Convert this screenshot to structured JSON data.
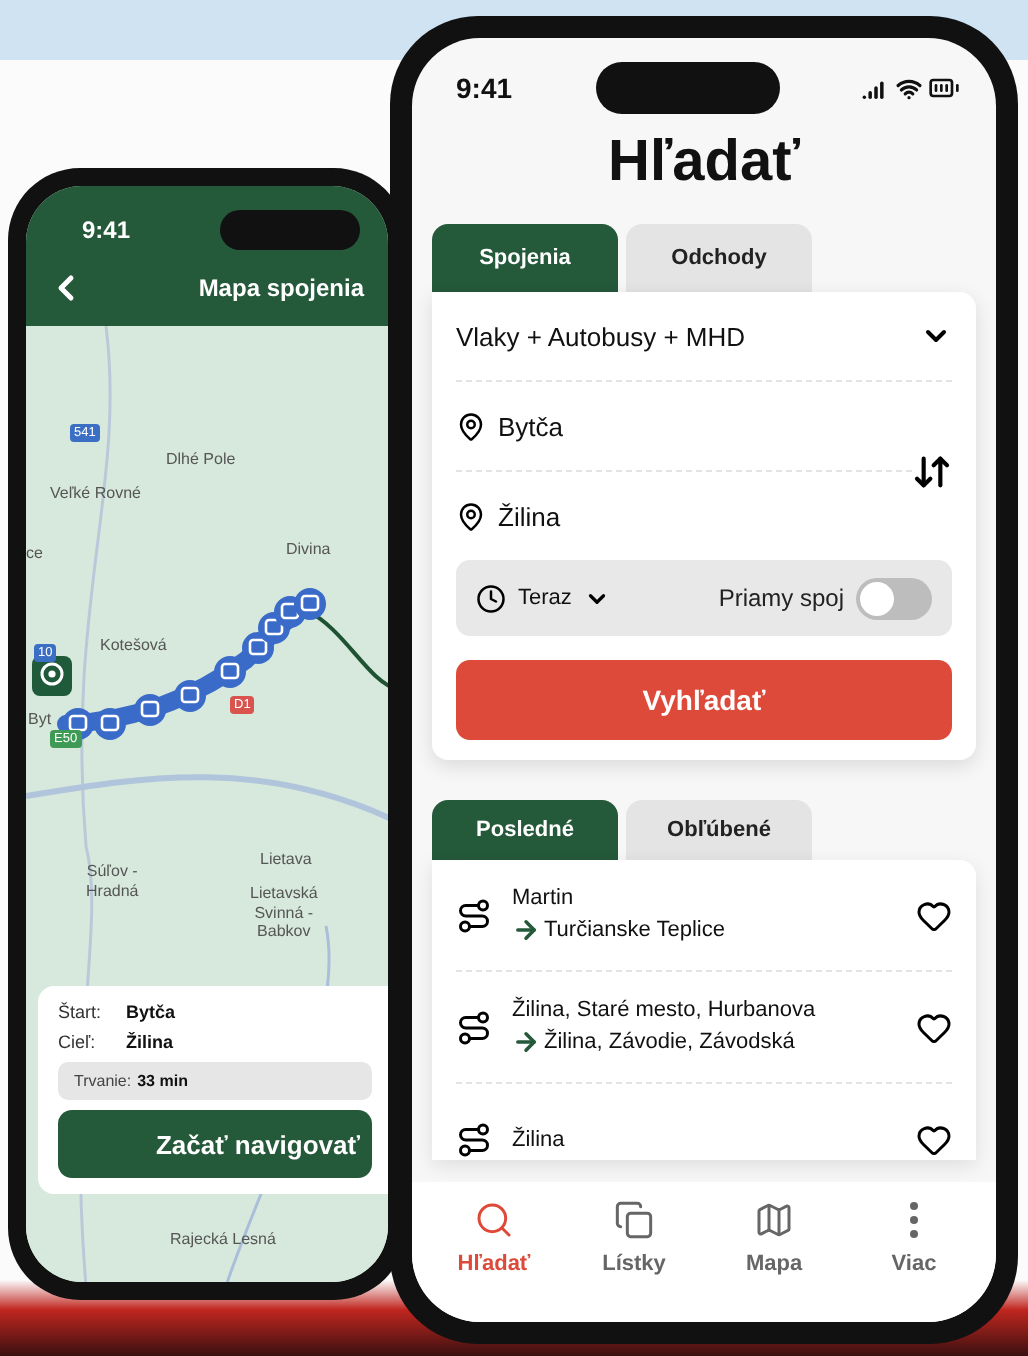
{
  "map_phone": {
    "status_time": "9:41",
    "header_title": "Mapa spojenia",
    "map": {
      "labels": [
        "Dlhé Pole",
        "Veľké Rovné",
        "ce",
        "Divina",
        "Kotešová",
        "Byt",
        "Súľov -\nHradná",
        "Lietava",
        "Lietavská\nSvinná -\nBabkov",
        "Rajecká Lesná"
      ],
      "road_signs": [
        {
          "text": "541",
          "color": "#3b6fc4"
        },
        {
          "text": "10",
          "color": "#3b6fc4"
        },
        {
          "text": "E50",
          "color": "#3f9a55"
        },
        {
          "text": "D1",
          "color": "#d9534f"
        }
      ]
    },
    "trip_card": {
      "start_label": "Štart:",
      "start": "Bytča",
      "end_label": "Cieľ:",
      "end": "Žilina",
      "duration_label": "Trvanie:",
      "duration": "33 min",
      "button": "Začať navigovať"
    }
  },
  "search_phone": {
    "status_time": "9:41",
    "title": "Hľadať",
    "mode_tabs": [
      {
        "label": "Spojenia",
        "selected": true
      },
      {
        "label": "Odchody",
        "selected": false
      }
    ],
    "transport_select": "Vlaky + Autobusy + MHD",
    "from": "Bytča",
    "to": "Žilina",
    "time": "Teraz",
    "direct": {
      "label": "Priamy spoj",
      "on": false
    },
    "search_button": "Vyhľadať",
    "list_tabs": [
      {
        "label": "Posledné",
        "selected": true
      },
      {
        "label": "Obľúbené",
        "selected": false
      }
    ],
    "recent": [
      {
        "from": "Martin",
        "to": "Turčianske Teplice"
      },
      {
        "from": "Žilina, Staré mesto, Hurbanova",
        "to": "Žilina, Závodie, Závodská"
      },
      {
        "from": "Žilina"
      }
    ],
    "nav": [
      {
        "label": "Hľadať",
        "selected": true
      },
      {
        "label": "Lístky",
        "selected": false
      },
      {
        "label": "Mapa",
        "selected": false
      },
      {
        "label": "Viac",
        "selected": false
      }
    ]
  }
}
